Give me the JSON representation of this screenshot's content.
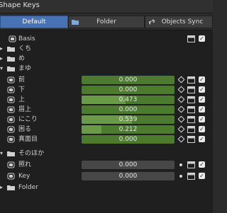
{
  "window": {
    "title": "Shape Keys"
  },
  "tabs": [
    {
      "label": "Default",
      "active": true
    },
    {
      "label": "Folder",
      "active": false
    },
    {
      "label": "Objects Sync",
      "active": false
    }
  ],
  "rows": {
    "basis": {
      "label": "Basis"
    },
    "kuchi": {
      "label": "くち"
    },
    "me": {
      "label": "め"
    },
    "mayu": {
      "label": "まゆ"
    },
    "mae": {
      "label": "前",
      "value": "0.000"
    },
    "shita": {
      "label": "下",
      "value": "0.000"
    },
    "ue": {
      "label": "上",
      "value": "0.473"
    },
    "mayujou": {
      "label": "眉上",
      "value": "0.000"
    },
    "nikori": {
      "label": "にこり",
      "value": "0.539"
    },
    "komaru": {
      "label": "困る",
      "value": "0.212"
    },
    "majime": {
      "label": "真面目",
      "value": "0.000"
    },
    "sonohoka": {
      "label": "そのほか"
    },
    "tere": {
      "label": "照れ",
      "value": "0.000"
    },
    "key": {
      "label": "Key",
      "value": "0.000"
    },
    "folder": {
      "label": "Folder"
    }
  },
  "colors": {
    "accent": "#4772b3",
    "slider_active": "#4c7a2f",
    "slider_fill": "#6a9a47",
    "slider_muted": "#474747"
  }
}
